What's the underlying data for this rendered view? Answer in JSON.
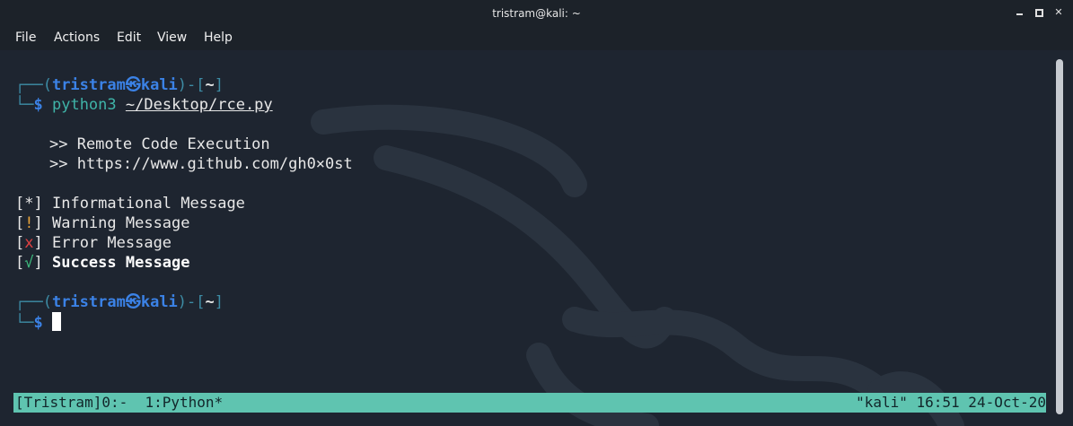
{
  "window": {
    "title": "tristram@kali: ~"
  },
  "menu": {
    "items": [
      "File",
      "Actions",
      "Edit",
      "View",
      "Help"
    ]
  },
  "prompt": {
    "frame_top_open": "┌──(",
    "user": "tristram",
    "at": "㉿",
    "host": "kali",
    "frame_mid": ")-[",
    "cwd": "~",
    "frame_close": "]",
    "frame_bottom": "└─",
    "dollar": "$"
  },
  "command": {
    "program": "python3",
    "argument": "~/Desktop/rce.py"
  },
  "output": {
    "banner_1": ">> Remote Code Execution",
    "banner_2": ">> https://www.github.com/gh0×0st",
    "messages": [
      {
        "mark": "*",
        "text": "Informational Message"
      },
      {
        "mark": "!",
        "text": "Warning Message"
      },
      {
        "mark": "x",
        "text": "Error Message"
      },
      {
        "mark": "√",
        "text": "Success Message"
      }
    ]
  },
  "statusbar": {
    "left": "[Tristram]0:-  1:Python*",
    "right": "\"kali\" 16:51 24-Oct-20"
  },
  "colors": {
    "background": "#1e2530",
    "prompt_blue": "#3b82e6",
    "frame": "#3d8ca5",
    "status_bg": "#5fc4b0",
    "warn": "#e8a33a",
    "error": "#e04141",
    "success": "#3fbf7f"
  }
}
